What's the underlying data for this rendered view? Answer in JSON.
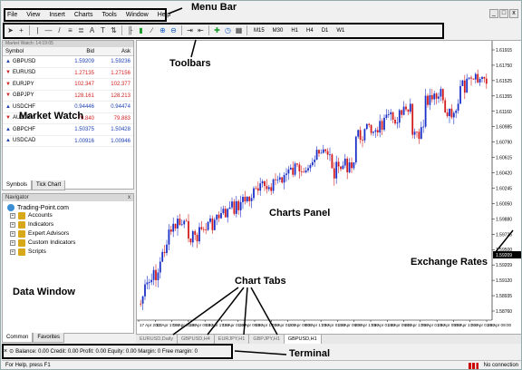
{
  "menu": {
    "items": [
      "File",
      "View",
      "Insert",
      "Charts",
      "Tools",
      "Window",
      "Help"
    ]
  },
  "window_controls": [
    "_",
    "□",
    "x"
  ],
  "toolbar": {
    "timeframes": [
      "M15",
      "M30",
      "H1",
      "H4",
      "D1",
      "W1"
    ]
  },
  "market_watch": {
    "title": "Market Watch: 14:19:05",
    "columns": [
      "Symbol",
      "Bid",
      "Ask"
    ],
    "rows": [
      {
        "symbol": "GBPUSD",
        "bid": "1.59209",
        "ask": "1.59236",
        "dir": "up"
      },
      {
        "symbol": "EURUSD",
        "bid": "1.27135",
        "ask": "1.27156",
        "dir": "down"
      },
      {
        "symbol": "EURJPY",
        "bid": "102.347",
        "ask": "102.377",
        "dir": "down"
      },
      {
        "symbol": "GBPJPY",
        "bid": "128.161",
        "ask": "128.213",
        "dir": "down"
      },
      {
        "symbol": "USDCHF",
        "bid": "0.94446",
        "ask": "0.94474",
        "dir": "up"
      },
      {
        "symbol": "AUDJPY",
        "bid": "79.840",
        "ask": "79.883",
        "dir": "down"
      },
      {
        "symbol": "GBPCHF",
        "bid": "1.50375",
        "ask": "1.50428",
        "dir": "up"
      },
      {
        "symbol": "USDCAD",
        "bid": "1.00916",
        "ask": "1.00946",
        "dir": "up"
      }
    ],
    "tabs": [
      "Symbols",
      "Tick Chart"
    ]
  },
  "navigator": {
    "title": "Navigator",
    "close": "x",
    "root": "Trading-Point.com",
    "items": [
      "Accounts",
      "Indicators",
      "Expert Advisors",
      "Custom Indicators",
      "Scripts"
    ],
    "tabs": [
      "Common",
      "Favorites"
    ]
  },
  "chart": {
    "price_labels": [
      "1.61915",
      "1.61750",
      "1.61525",
      "1.61355",
      "1.61160",
      "1.60985",
      "1.60790",
      "1.60615",
      "1.60420",
      "1.60245",
      "1.60050",
      "1.59880",
      "1.59725",
      "1.59500",
      "1.59209",
      "1.59120",
      "1.58935",
      "1.58760"
    ],
    "current_price": "1.59209",
    "date_labels": [
      "17 Apr 2012",
      "17 Apr 17:00",
      "18 Apr 01:00",
      "18 Apr 09:00",
      "18 Apr 17:00",
      "19 Apr 01:00",
      "19 Apr 09:00",
      "19 Apr 17:00",
      "20 Apr 01:00",
      "20 Apr 09:00",
      "20 Apr 17:00",
      "23 Apr 01:00",
      "23 Apr 09:00",
      "23 Apr 17:00",
      "24 Apr 01:00",
      "24 Apr 09:00",
      "24 Apr 17:00",
      "25 Apr 01:00",
      "25 Apr 09:00",
      "25 Apr 17:00",
      "26 Apr 01:00",
      "26 Apr 09:00"
    ],
    "tabs": [
      "EURUSD,Daily",
      "GBPUSD,H4",
      "EURJPY,H1",
      "GBPJPY,H1",
      "GBPUSD,H1"
    ],
    "active_tab": 4
  },
  "terminal": {
    "text": "Balance: 0.00  Credit: 0.00  Profit: 0.00  Equity: 0.00  Margin: 0  Free margin: 0"
  },
  "status": {
    "help": "For Help, press F1",
    "connection": "No connection"
  },
  "annotations": {
    "menu_bar": "Menu Bar",
    "toolbars": "Toolbars",
    "market_watch": "Market Watch",
    "charts_panel": "Charts Panel",
    "exchange_rates": "Exchange Rates",
    "chart_tabs": "Chart Tabs",
    "data_window": "Data Window",
    "terminal": "Terminal"
  }
}
